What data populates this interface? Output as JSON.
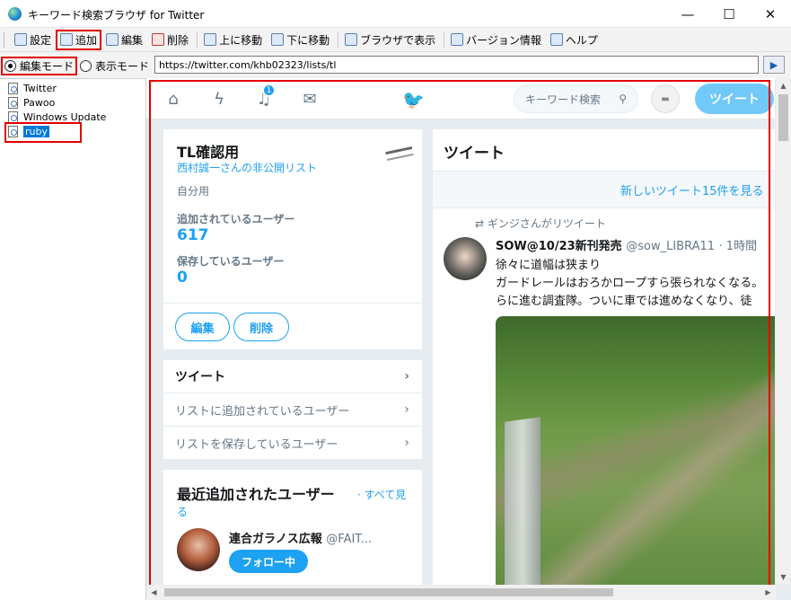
{
  "window": {
    "title": "キーワード検索ブラウザ for Twitter",
    "minimize": "—",
    "maximize": "☐",
    "close": "✕"
  },
  "toolbar": {
    "settings": "設定",
    "add": "追加",
    "edit": "編集",
    "delete": "削除",
    "move_up": "上に移動",
    "move_down": "下に移動",
    "open_browser": "ブラウザで表示",
    "version": "バージョン情報",
    "help": "ヘルプ"
  },
  "modes": {
    "edit_mode": "編集モード",
    "view_mode": "表示モード"
  },
  "address": {
    "url": "https://twitter.com/khb02323/lists/tl",
    "go": "▶"
  },
  "tree": {
    "items": [
      {
        "label": "Twitter"
      },
      {
        "label": "Pawoo"
      },
      {
        "label": "Windows Update"
      },
      {
        "label": "ruby"
      }
    ]
  },
  "twitter": {
    "badge_count": "1",
    "search_placeholder": "キーワード検索",
    "tweet_button": "ツイート",
    "list": {
      "title": "TL確認用",
      "owner": "西村誠一さんの非公開リスト",
      "description": "自分用",
      "members_label": "追加されているユーザー",
      "members_count": "617",
      "subscribers_label": "保存しているユーザー",
      "subscribers_count": "0",
      "edit_button": "編集",
      "delete_button": "削除"
    },
    "menu": {
      "tweets": "ツイート",
      "members": "リストに追加されているユーザー",
      "subscribers": "リストを保存しているユーザー"
    },
    "recent_users": {
      "title": "最近追加されたユーザー",
      "see_all_a": "· すべて見",
      "see_all_b": "る",
      "user_name": "連合ガラノス広報",
      "user_handle": "@FAIT...",
      "follow_button": "フォロー中"
    },
    "timeline": {
      "title": "ツイート",
      "new_tweets": "新しいツイート15件を見る",
      "retweet_by": "ギンジさんがリツイート",
      "author": "SOW@10/23新刊発売",
      "handle": "@sow_LIBRA11",
      "time": "· 1時間",
      "line1": "徐々に道幅は狭まり",
      "line2": "ガードレールはおろかロープすら張られなくなる。",
      "line3": "らに進む調査隊。ついに車では進めなくなり、徒"
    }
  }
}
